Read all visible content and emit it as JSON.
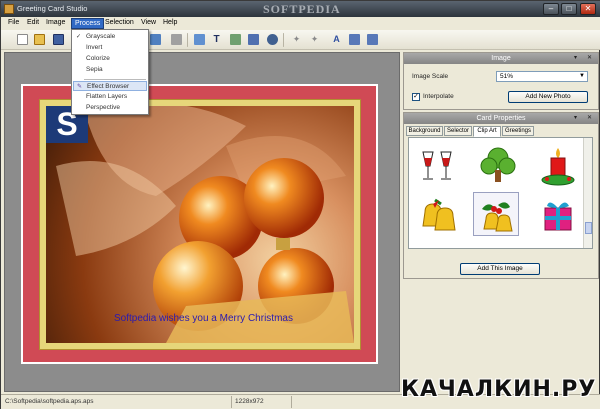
{
  "window": {
    "title": "Greeting Card Studio",
    "watermark": "SOFTPEDIA"
  },
  "menu": [
    "File",
    "Edit",
    "Image",
    "Process",
    "Selection",
    "View",
    "Help"
  ],
  "process_menu": {
    "items": [
      "Grayscale",
      "Invert",
      "Colorize",
      "Sepia",
      "Effect Browser",
      "Flatten Layers",
      "Perspective"
    ]
  },
  "card": {
    "logo_letter": "S",
    "message": "Softpedia wishes you a Merry Christmas"
  },
  "image_panel": {
    "title": "Image",
    "scale_label": "Image Scale",
    "scale_value": "51%",
    "interpolate_label": "Interpolate",
    "interpolate_checked": true,
    "add_photo_button": "Add New Photo"
  },
  "card_props_panel": {
    "title": "Card Properties",
    "tabs": [
      "Background",
      "Selector",
      "Clip Art",
      "Greetings"
    ],
    "active_tab": "Clip Art",
    "clipart": [
      "wine-glasses-icon",
      "tree-icon",
      "candle-icon",
      "bells-icon",
      "holly-bells-icon",
      "gift-icon"
    ],
    "add_image_button": "Add This Image"
  },
  "status": {
    "path": "C:\\Softpedia\\softpedia.aps.aps",
    "size": "1228x972"
  },
  "brand_overlay": "КАЧАЛКИН.РУ"
}
